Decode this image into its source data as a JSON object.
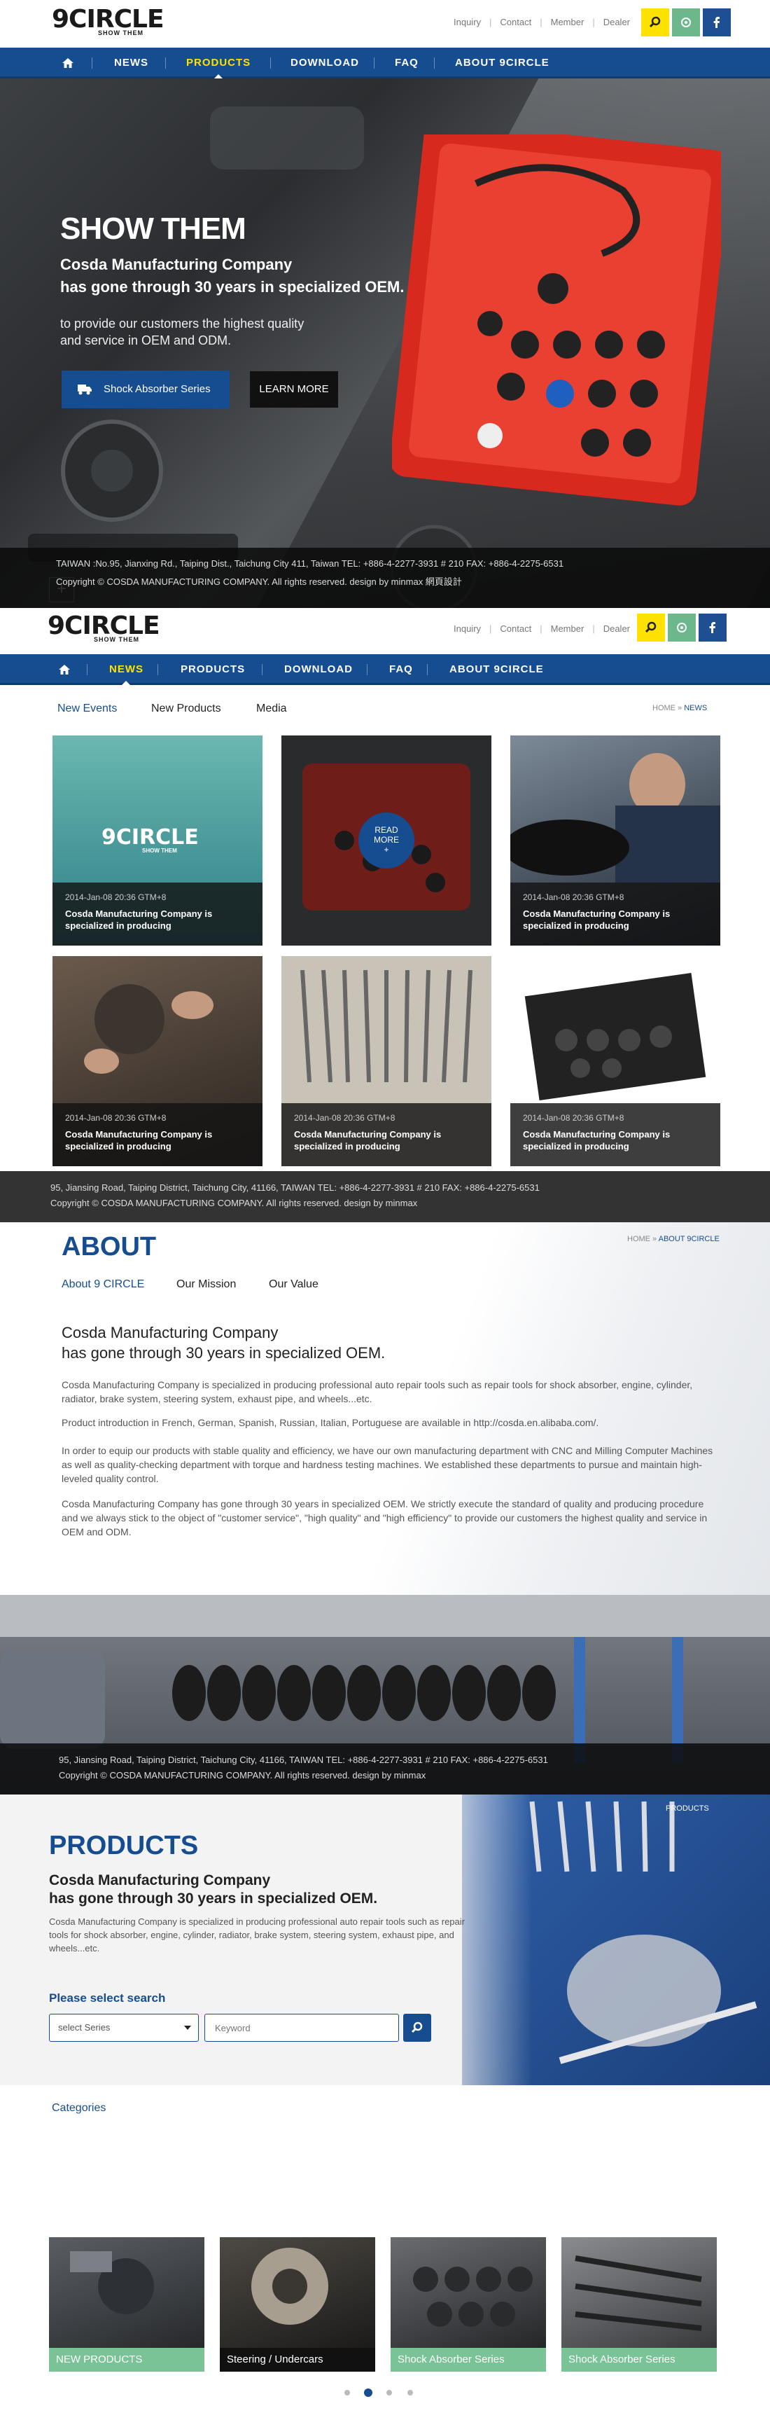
{
  "header1": {
    "logo_main": "9CIRCLE",
    "logo_sub": "SHOW THEM",
    "links": [
      "Inquiry",
      "Contact",
      "Member",
      "Dealer"
    ]
  },
  "nav1": {
    "items": [
      "NEWS",
      "PRODUCTS",
      "DOWNLOAD",
      "FAQ",
      "ABOUT 9CIRCLE"
    ],
    "active": "PRODUCTS"
  },
  "hero": {
    "headline": "SHOW THEM",
    "subline1": "Cosda Manufacturing Company",
    "subline2": "has gone through 30 years in specialized OEM.",
    "desc1": "to provide our customers the highest quality",
    "desc2": "and service in OEM and ODM.",
    "primary_button": "Shock Absorber Series",
    "secondary_button": "LEARN MORE",
    "plus": "+",
    "address": "TAIWAN :No.95, Jianxing Rd., Taiping Dist., Taichung City 411, Taiwan      TEL: +886-4-2277-3931 # 210      FAX: +886-4-2275-6531",
    "copyright": "Copyright © COSDA MANUFACTURING COMPANY.    All rights reserved. design by minmax 網頁設計"
  },
  "header2": {
    "logo_main": "9CIRCLE",
    "logo_sub": "SHOW THEM",
    "links": [
      "Inquiry",
      "Contact",
      "Member",
      "Dealer"
    ]
  },
  "nav2": {
    "items": [
      "NEWS",
      "PRODUCTS",
      "DOWNLOAD",
      "FAQ",
      "ABOUT 9CIRCLE"
    ],
    "active": "NEWS"
  },
  "news": {
    "tabs": [
      "New Events",
      "New Products",
      "Media"
    ],
    "breadcrumb_home": "HOME",
    "breadcrumb_sep": " » ",
    "breadcrumb_current": "NEWS",
    "card_logo_main": "9CIRCLE",
    "card_logo_sub": "SHOW THEM",
    "read_more_1": "READ",
    "read_more_2": "MORE",
    "read_more_plus": "+",
    "cards": [
      {
        "date": "2014-Jan-08   20:36 GTM+8",
        "title": "Cosda Manufacturing Company is specialized in producing"
      },
      {
        "date": "",
        "title": ""
      },
      {
        "date": "2014-Jan-08   20:36 GTM+8",
        "title": "Cosda Manufacturing Company is specialized in producing"
      },
      {
        "date": "2014-Jan-08   20:36 GTM+8",
        "title": "Cosda Manufacturing Company is specialized in producing"
      },
      {
        "date": "2014-Jan-08   20:36 GTM+8",
        "title": "Cosda Manufacturing Company is specialized in producing"
      },
      {
        "date": "2014-Jan-08   20:36 GTM+8",
        "title": "Cosda Manufacturing Company is specialized in producing"
      }
    ],
    "address": "95, Jiansing Road, Taiping District, Taichung City, 41166, TAIWAN    TEL: +886-4-2277-3931 # 210    FAX: +886-4-2275-6531",
    "copyright": "Copyright © COSDA MANUFACTURING COMPANY.     All rights reserved. design by minmax"
  },
  "about": {
    "title": "ABOUT",
    "breadcrumb_home": "HOME",
    "breadcrumb_sep": " » ",
    "breadcrumb_current": "ABOUT 9CIRCLE",
    "tabs": [
      "About 9 CIRCLE",
      "Our Mission",
      "Our Value"
    ],
    "heading1": "Cosda Manufacturing Company",
    "heading2": "has gone through 30 years in specialized OEM.",
    "p1": "Cosda Manufacturing Company is specialized in producing professional auto repair tools such as repair tools for shock absorber, engine, cylinder, radiator, brake system, steering system, exhaust pipe, and wheels...etc.",
    "p2": "Product introduction in French, German, Spanish, Russian, Italian, Portuguese are available in http://cosda.en.alibaba.com/.",
    "p3": "In order to equip our products with stable quality and efficiency, we have our own manufacturing department with CNC and Milling Computer Machines as well as quality-checking department with torque and hardness testing machines. We established these departments to pursue and maintain high-leveled quality control.",
    "p4": "Cosda Manufacturing Company has gone through 30 years in specialized OEM. We strictly execute the standard of quality and producing procedure and we always stick to the object of \"customer service\", \"high quality\" and \"high efficiency\" to provide our customers the highest quality and service in OEM and ODM.",
    "address": "95, Jiansing Road, Taiping District, Taichung City, 41166, TAIWAN    TEL: +886-4-2277-3931 # 210    FAX: +886-4-2275-6531",
    "copyright": "Copyright © COSDA MANUFACTURING COMPANY.     All rights reserved. design by minmax"
  },
  "products": {
    "title": "PRODUCTS",
    "breadcrumb": "PRODUCTS",
    "heading1": "Cosda Manufacturing Company",
    "heading2": "has gone through 30 years in specialized OEM.",
    "desc": "Cosda Manufacturing Company is specialized in producing professional auto repair tools such as repair tools for shock absorber, engine, cylinder, radiator, brake system, steering system, exhaust pipe, and wheels...etc.",
    "search_label": "Please select search",
    "select_value": "select Series",
    "keyword_placeholder": "Keyword",
    "categories_label": "Categories",
    "categories": [
      "NEW PRODUCTS",
      "Steering / Undercars",
      "Shock Absorber Series",
      "Shock Absorber Series"
    ]
  },
  "colors": {
    "brand_blue": "#164d91",
    "accent_yellow": "#ffe100",
    "category_green": "#79c396"
  }
}
